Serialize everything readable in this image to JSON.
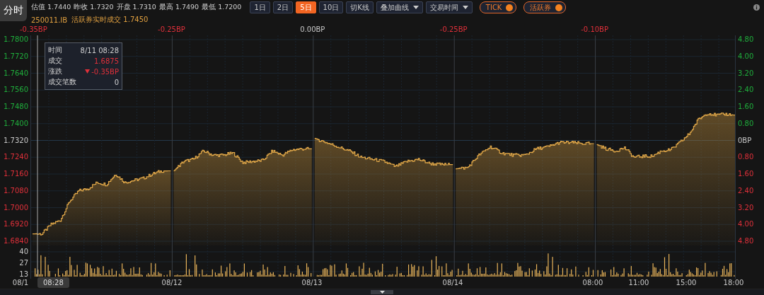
{
  "tab": {
    "label": "分时",
    "selected": true
  },
  "quote": [
    {
      "label": "估值",
      "value": "1.7440"
    },
    {
      "label": "昨收",
      "value": "1.7320"
    },
    {
      "label": "开盘",
      "value": "1.7310"
    },
    {
      "label": "最高",
      "value": "1.7490"
    },
    {
      "label": "最低",
      "value": "1.7200"
    }
  ],
  "period_buttons": [
    {
      "label": "1日",
      "selected": false
    },
    {
      "label": "2日",
      "selected": false
    },
    {
      "label": "5日",
      "selected": true
    },
    {
      "label": "10日",
      "selected": false
    }
  ],
  "kline_button": "切K线",
  "dropdowns": [
    "叠加曲线",
    "交易时间"
  ],
  "toggles": [
    {
      "label": "TICK",
      "on": true
    },
    {
      "label": "活跃券",
      "on": true
    }
  ],
  "active_bond": {
    "code": "250011.IB",
    "label": "活跃券实时成交",
    "value": "1.7450"
  },
  "day_changes": [
    {
      "text": "-0.35BP",
      "color": "#e0303a"
    },
    {
      "text": "-0.25BP",
      "color": "#e0303a"
    },
    {
      "text": "0.00BP",
      "color": "#c8c8c8"
    },
    {
      "text": "-0.25BP",
      "color": "#e0303a"
    },
    {
      "text": "-0.10BP",
      "color": "#e0303a"
    }
  ],
  "price_axis": [
    {
      "label": "1.7800",
      "color": "#1fae3c"
    },
    {
      "label": "1.7720",
      "color": "#1fae3c"
    },
    {
      "label": "1.7640",
      "color": "#1fae3c"
    },
    {
      "label": "1.7560",
      "color": "#1fae3c"
    },
    {
      "label": "1.7480",
      "color": "#1fae3c"
    },
    {
      "label": "1.7400",
      "color": "#1fae3c"
    },
    {
      "label": "1.7320",
      "color": "#c8c8c8"
    },
    {
      "label": "1.7240",
      "color": "#e0303a"
    },
    {
      "label": "1.7160",
      "color": "#e0303a"
    },
    {
      "label": "1.7080",
      "color": "#e0303a"
    },
    {
      "label": "1.7000",
      "color": "#e0303a"
    },
    {
      "label": "1.6920",
      "color": "#e0303a"
    },
    {
      "label": "1.6840",
      "color": "#e0303a"
    }
  ],
  "change_axis": [
    {
      "label": "4.80",
      "color": "#1fae3c"
    },
    {
      "label": "4.00",
      "color": "#1fae3c"
    },
    {
      "label": "3.20",
      "color": "#1fae3c"
    },
    {
      "label": "2.40",
      "color": "#1fae3c"
    },
    {
      "label": "1.60",
      "color": "#1fae3c"
    },
    {
      "label": "0.80",
      "color": "#1fae3c"
    },
    {
      "label": "0BP",
      "color": "#c8c8c8"
    },
    {
      "label": "0.80",
      "color": "#e0303a"
    },
    {
      "label": "1.60",
      "color": "#e0303a"
    },
    {
      "label": "2.40",
      "color": "#e0303a"
    },
    {
      "label": "3.20",
      "color": "#e0303a"
    },
    {
      "label": "4.00",
      "color": "#e0303a"
    },
    {
      "label": "4.80",
      "color": "#e0303a"
    }
  ],
  "volume_axis": [
    "40",
    "27",
    "13"
  ],
  "time_axis": [
    "08/1",
    "08/12",
    "08/13",
    "08/14",
    "08:00",
    "11:00",
    "15:00",
    "18:00"
  ],
  "crosshair": {
    "time": "08:28"
  },
  "tooltip": [
    {
      "label": "时间",
      "value": "8/11 08:28",
      "kind": "text"
    },
    {
      "label": "成交",
      "value": "1.6875",
      "kind": "text",
      "color": "#e0303a"
    },
    {
      "label": "涨跌",
      "value": "-0.35BP",
      "kind": "change",
      "color": "#e0303a"
    },
    {
      "label": "成交笔数",
      "value": "0",
      "kind": "text"
    }
  ]
}
